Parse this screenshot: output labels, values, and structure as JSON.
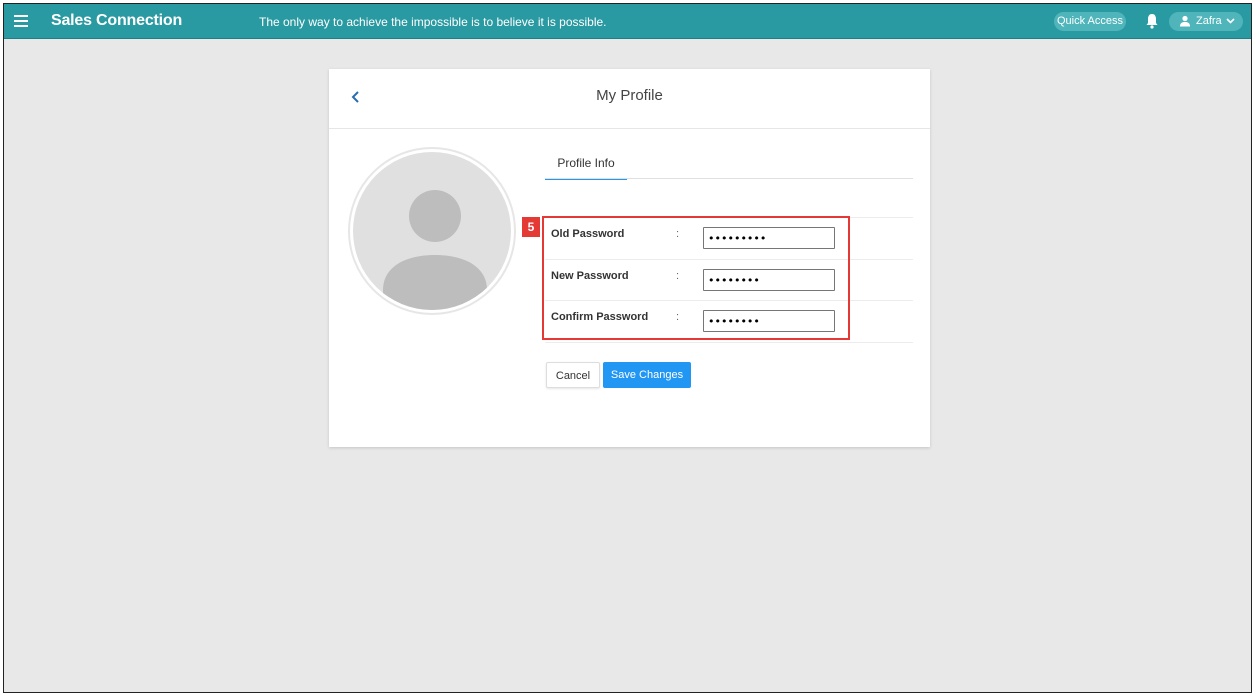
{
  "topbar": {
    "app_title": "Sales Connection",
    "quote": "The only way to achieve the impossible is to believe it is possible.",
    "quick_access": "Quick Access",
    "user_name": "Zafra",
    "bg_color": "#2a9aa2"
  },
  "card": {
    "title": "My Profile",
    "tab": "Profile Info",
    "step_badge": "5",
    "fields": [
      {
        "label": "Old Password",
        "colon": ":",
        "value": "•••••••••"
      },
      {
        "label": "New Password",
        "colon": ":",
        "value": "••••••••"
      },
      {
        "label": "Confirm Password",
        "colon": ":",
        "value": "••••••••"
      }
    ],
    "cancel_label": "Cancel",
    "save_label": "Save Changes"
  },
  "icons": [
    "menu-icon",
    "bell-icon",
    "user-icon",
    "chevron-down-icon",
    "back-arrow-icon",
    "avatar-placeholder-icon"
  ]
}
